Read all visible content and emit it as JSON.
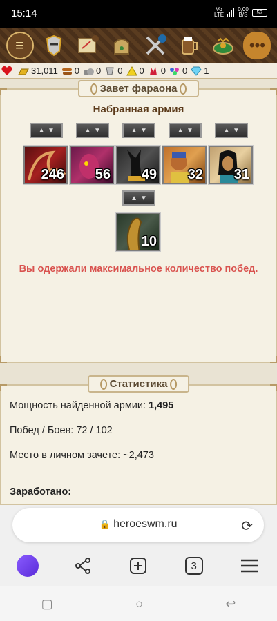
{
  "status_bar": {
    "time": "15:14",
    "network": "Vo LTE",
    "data_rate": "0,00 B/S",
    "battery": "57"
  },
  "resources": [
    {
      "icon": "heart-icon",
      "value": ""
    },
    {
      "icon": "gold-icon",
      "value": "31,011"
    },
    {
      "icon": "wood-icon",
      "value": "0"
    },
    {
      "icon": "ore-icon",
      "value": "0"
    },
    {
      "icon": "mercury-icon",
      "value": "0"
    },
    {
      "icon": "sulfur-icon",
      "value": "0"
    },
    {
      "icon": "crystal-icon",
      "value": "0"
    },
    {
      "icon": "gems-icon",
      "value": "0"
    },
    {
      "icon": "diamond-icon",
      "value": "1"
    }
  ],
  "panel1": {
    "title": "Завет фараона",
    "army_title": "Набранная армия",
    "units": [
      {
        "name": "unit-demon",
        "count": "246"
      },
      {
        "name": "unit-imp",
        "count": "56"
      },
      {
        "name": "unit-anubis",
        "count": "49"
      },
      {
        "name": "unit-archer",
        "count": "32"
      },
      {
        "name": "unit-priestess",
        "count": "31"
      },
      {
        "name": "unit-cobra",
        "count": "10"
      }
    ],
    "message": "Вы одержали максимальное количество побед."
  },
  "panel2": {
    "title": "Статистика",
    "power_label": "Мощность найденной армии:",
    "power_value": "1,495",
    "wins_line": "Побед / Боев: 72 / 102",
    "rank_line": "Место в личном зачете: ~2,473",
    "earned_label": "Заработано:"
  },
  "browser": {
    "url": "heroeswm.ru",
    "tabs_count": "3"
  }
}
